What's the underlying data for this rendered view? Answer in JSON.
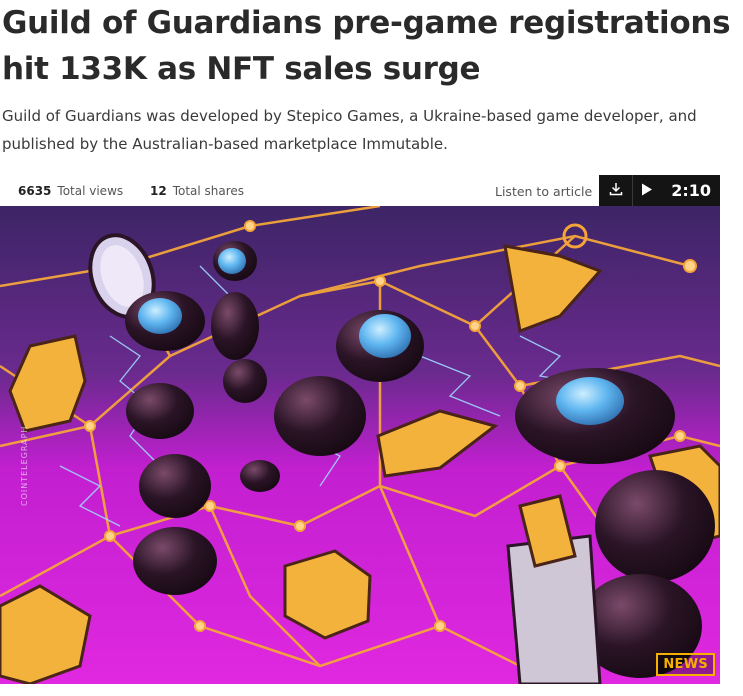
{
  "article": {
    "headline": "Guild of Guardians pre-game registrations hit 133K as NFT sales surge",
    "lede": "Guild of Guardians was developed by Stepico Games, a Ukraine-based game developer, and published by the Australian-based marketplace Immutable."
  },
  "stats": {
    "views_count": "6635",
    "views_label": "Total views",
    "shares_count": "12",
    "shares_label": "Total shares"
  },
  "audio": {
    "listen_label": "Listen to article",
    "duration": "2:10",
    "download_icon": "download-icon",
    "play_icon": "play-icon"
  },
  "hero": {
    "badge": "NEWS",
    "watermark": "COINTELEGRAPH",
    "colors": {
      "sky_top": "#4b2a7a",
      "magenta": "#d81fd8",
      "network": "#f4a53a",
      "ant_body": "#1f0f1c",
      "ant_eye": "#5fb6f0",
      "token": "#f3b23c"
    }
  }
}
